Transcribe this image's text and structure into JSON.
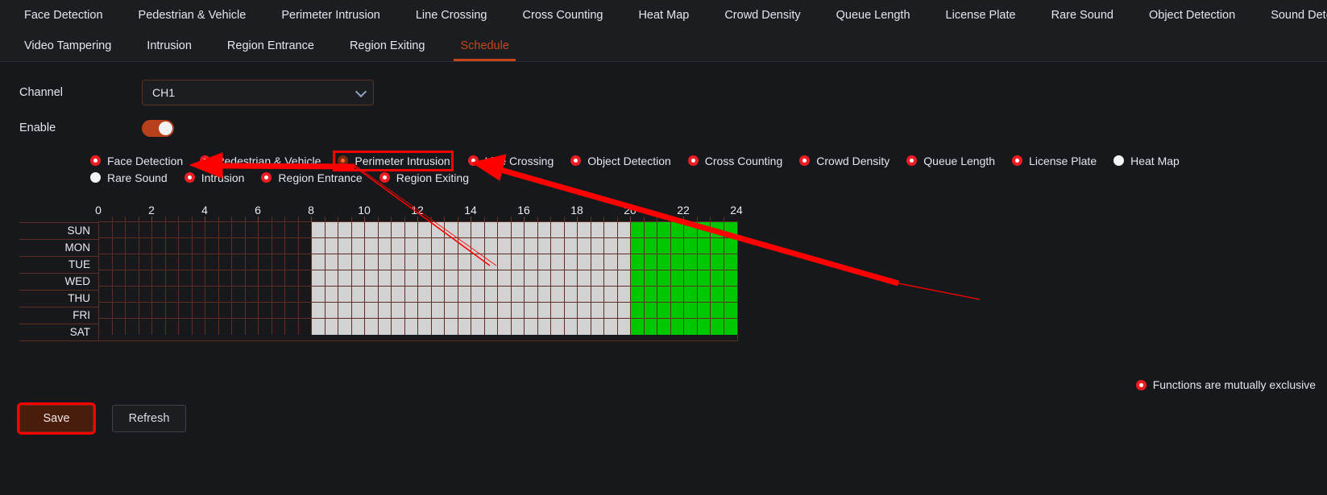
{
  "nav": {
    "rows": [
      [
        {
          "label": "Face Detection",
          "active": false
        },
        {
          "label": "Pedestrian & Vehicle",
          "active": false
        },
        {
          "label": "Perimeter Intrusion",
          "active": false
        },
        {
          "label": "Line Crossing",
          "active": false
        },
        {
          "label": "Cross Counting",
          "active": false
        },
        {
          "label": "Heat Map",
          "active": false
        },
        {
          "label": "Crowd Density",
          "active": false
        },
        {
          "label": "Queue Length",
          "active": false
        },
        {
          "label": "License Plate",
          "active": false
        },
        {
          "label": "Rare Sound",
          "active": false
        },
        {
          "label": "Object Detection",
          "active": false
        },
        {
          "label": "Sound Detection",
          "active": false
        }
      ],
      [
        {
          "label": "Video Tampering",
          "active": false
        },
        {
          "label": "Intrusion",
          "active": false
        },
        {
          "label": "Region Entrance",
          "active": false
        },
        {
          "label": "Region Exiting",
          "active": false
        },
        {
          "label": "Schedule",
          "active": true
        }
      ]
    ]
  },
  "form": {
    "channel_label": "Channel",
    "channel_value": "CH1",
    "enable_label": "Enable",
    "enable_on": true
  },
  "functions": {
    "rows": [
      [
        {
          "label": "Face Detection",
          "state": "on"
        },
        {
          "label": "Pedestrian & Vehicle",
          "state": "on"
        },
        {
          "label": "Perimeter Intrusion",
          "state": "selected",
          "highlighted": true
        },
        {
          "label": "Line Crossing",
          "state": "on"
        },
        {
          "label": "Object Detection",
          "state": "on"
        },
        {
          "label": "Cross Counting",
          "state": "on"
        },
        {
          "label": "Crowd Density",
          "state": "on"
        },
        {
          "label": "Queue Length",
          "state": "on"
        },
        {
          "label": "License Plate",
          "state": "on"
        },
        {
          "label": "Heat Map",
          "state": "off"
        }
      ],
      [
        {
          "label": "Rare Sound",
          "state": "off"
        },
        {
          "label": "Intrusion",
          "state": "on"
        },
        {
          "label": "Region Entrance",
          "state": "on"
        },
        {
          "label": "Region Exiting",
          "state": "on"
        }
      ]
    ]
  },
  "schedule": {
    "hour_labels": [
      "0",
      "2",
      "4",
      "6",
      "8",
      "10",
      "12",
      "14",
      "16",
      "18",
      "20",
      "22",
      "24"
    ],
    "days": [
      "SUN",
      "MON",
      "TUE",
      "WED",
      "THU",
      "FRI",
      "SAT"
    ],
    "cells_per_hour": 2,
    "total_cells": 48,
    "colors": {
      "empty": "#16181c",
      "gray": "#d2d2d2",
      "green": "#00c800",
      "gridline": "#5c2f22"
    },
    "segments": [
      {
        "from_cell": 0,
        "to_cell": 16,
        "fill": "empty"
      },
      {
        "from_cell": 16,
        "to_cell": 40,
        "fill": "gray"
      },
      {
        "from_cell": 40,
        "to_cell": 48,
        "fill": "green"
      }
    ]
  },
  "legend": {
    "text": "Functions are mutually exclusive"
  },
  "buttons": {
    "save": "Save",
    "refresh": "Refresh"
  },
  "annotation": {
    "color": "#ff0000"
  }
}
